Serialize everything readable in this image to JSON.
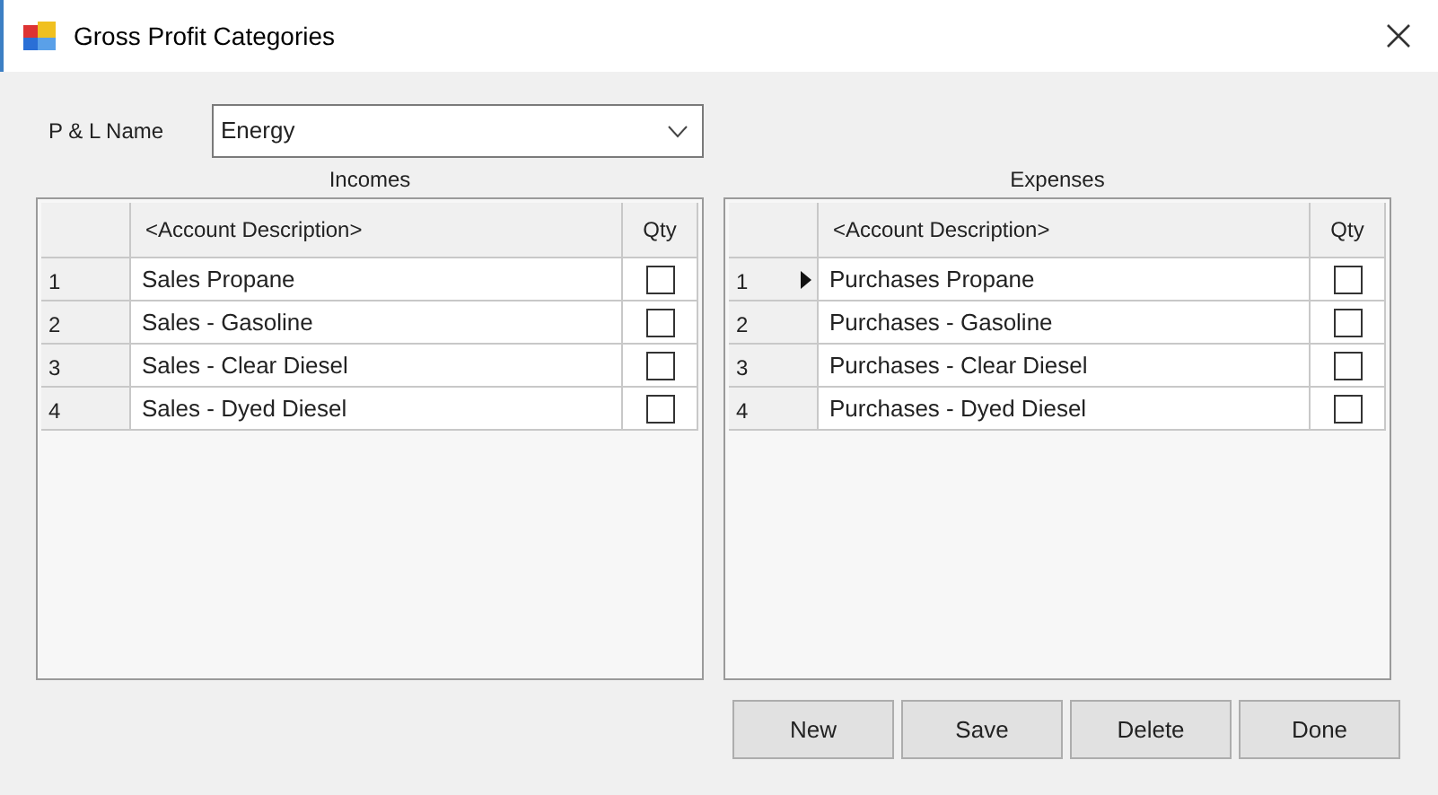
{
  "window": {
    "title": "Gross Profit Categories"
  },
  "pl_name": {
    "label": "P & L Name",
    "value": "Energy"
  },
  "grids": [
    {
      "title": "Incomes",
      "columns": [
        "<Account Description>",
        "Qty"
      ],
      "rows": [
        {
          "number": "1",
          "description": "Sales Propane",
          "qty_checked": false,
          "current": false
        },
        {
          "number": "2",
          "description": "Sales - Gasoline",
          "qty_checked": false,
          "current": false
        },
        {
          "number": "3",
          "description": "Sales - Clear Diesel",
          "qty_checked": false,
          "current": false
        },
        {
          "number": "4",
          "description": "Sales - Dyed Diesel",
          "qty_checked": false,
          "current": false
        }
      ]
    },
    {
      "title": "Expenses",
      "columns": [
        "<Account Description>",
        "Qty"
      ],
      "rows": [
        {
          "number": "1",
          "description": "Purchases Propane",
          "qty_checked": false,
          "current": true
        },
        {
          "number": "2",
          "description": "Purchases - Gasoline",
          "qty_checked": false,
          "current": false
        },
        {
          "number": "3",
          "description": "Purchases - Clear Diesel",
          "qty_checked": false,
          "current": false
        },
        {
          "number": "4",
          "description": "Purchases - Dyed Diesel",
          "qty_checked": false,
          "current": false
        }
      ]
    }
  ],
  "buttons": [
    "New",
    "Save",
    "Delete",
    "Done"
  ]
}
